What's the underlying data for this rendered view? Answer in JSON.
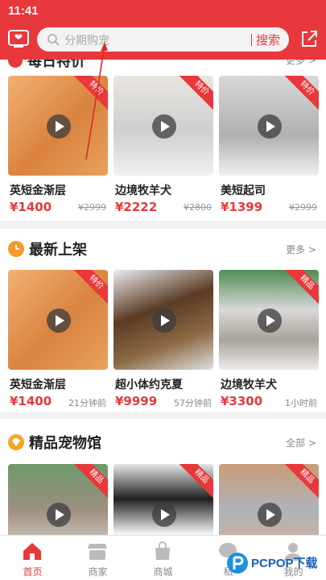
{
  "status": {
    "time": "11:41"
  },
  "header": {
    "search_placeholder": "分期购宠",
    "search_button": "搜索",
    "left_icon": "tv-icon",
    "right_icon": "share-icon"
  },
  "sections": [
    {
      "title": "每日特价",
      "more": "更多 >",
      "items": [
        {
          "name": "英短金渐层",
          "price": "¥1400",
          "old_price": "¥2999",
          "tag": "特价"
        },
        {
          "name": "边境牧羊犬",
          "price": "¥2222",
          "old_price": "¥2800",
          "tag": "特价"
        },
        {
          "name": "美短起司",
          "price": "¥1399",
          "old_price": "¥2999",
          "tag": "特价"
        }
      ]
    },
    {
      "title": "最新上架",
      "more": "更多 >",
      "items": [
        {
          "name": "英短金渐层",
          "price": "¥1400",
          "time": "21分钟前",
          "tag": "特价"
        },
        {
          "name": "超小体约克夏",
          "price": "¥9999",
          "time": "57分钟前"
        },
        {
          "name": "边境牧羊犬",
          "price": "¥3300",
          "time": "1小时前",
          "tag": "精品"
        }
      ]
    },
    {
      "title": "精品宠物馆",
      "more": "全部 >",
      "items": [
        {
          "tag": "精品"
        },
        {
          "tag": "精品"
        },
        {
          "tag": "精品"
        }
      ]
    }
  ],
  "tabbar": [
    {
      "label": "首页",
      "icon": "home-icon",
      "active": true
    },
    {
      "label": "商家",
      "icon": "store-icon"
    },
    {
      "label": "商城",
      "icon": "shopping-bag-icon"
    },
    {
      "label": "私",
      "icon": "message-icon"
    },
    {
      "label": "我的",
      "icon": "user-icon"
    }
  ],
  "watermark": {
    "text": "PCPOP下载"
  },
  "colors": {
    "accent": "#e8383b",
    "tab_active": "#e8383b"
  }
}
